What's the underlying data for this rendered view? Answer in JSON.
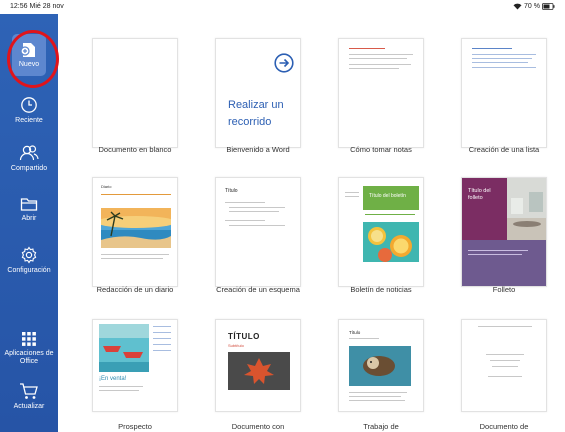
{
  "status": {
    "time": "12:56",
    "date": "Mié 28 nov",
    "battery": "70 %"
  },
  "sidebar": {
    "items": [
      {
        "label": "Nuevo",
        "icon": "new-document-icon"
      },
      {
        "label": "Reciente",
        "icon": "clock-icon"
      },
      {
        "label": "Compartido",
        "icon": "people-icon"
      },
      {
        "label": "Abrir",
        "icon": "folder-icon"
      },
      {
        "label": "Configuración",
        "icon": "gear-icon"
      },
      {
        "label": "Aplicaciones de Office",
        "icon": "app-grid-icon"
      },
      {
        "label": "Actualizar",
        "icon": "cart-icon"
      }
    ]
  },
  "templates": [
    {
      "caption": "Documento en blanco"
    },
    {
      "caption": "Bienvenido a Word",
      "preview": "Realizar un recorrido"
    },
    {
      "caption": "Cómo tomar notas"
    },
    {
      "caption": "Creación de una lista"
    },
    {
      "caption": "Redacción de un diario",
      "preview": "Diario"
    },
    {
      "caption": "Creación de un esquema",
      "preview": "Título"
    },
    {
      "caption": "Boletín de noticias",
      "preview": "Título del boletín"
    },
    {
      "caption": "Folleto",
      "preview": "Título del folleto"
    },
    {
      "caption": "Prospecto",
      "preview": "¡En venta!"
    },
    {
      "caption": "Documento con",
      "preview": "TÍTULO",
      "preview_sub": "Subtítulo"
    },
    {
      "caption": "Trabajo de",
      "preview": "Título"
    },
    {
      "caption": "Documento de"
    }
  ],
  "colors": {
    "sidebar": "#2e63b6",
    "accent": "#2c5fb3",
    "highlight": "#e0141b"
  }
}
